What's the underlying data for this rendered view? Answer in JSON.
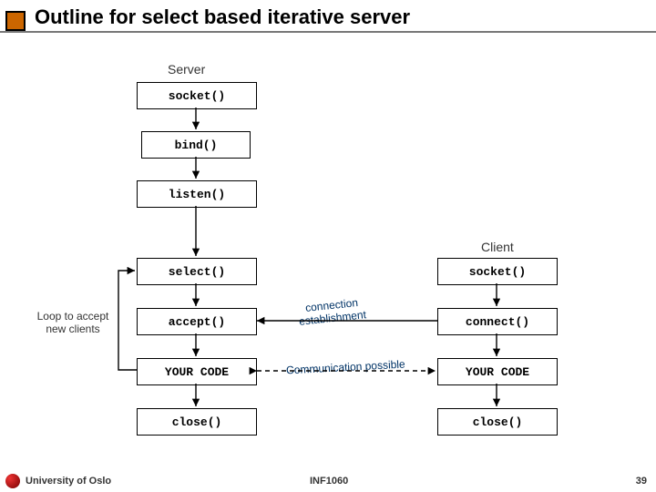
{
  "title": "Outline for select based iterative server",
  "server": {
    "heading": "Server",
    "socket": "socket()",
    "bind": "bind()",
    "listen": "listen()",
    "select": "select()",
    "accept": "accept()",
    "your_code": "YOUR CODE",
    "close": "close()"
  },
  "client": {
    "heading": "Client",
    "socket": "socket()",
    "connect": "connect()",
    "your_code": "YOUR CODE",
    "close": "close()"
  },
  "annotations": {
    "loop": "Loop to accept\nnew clients",
    "conn1": "connection",
    "conn2": "establishment",
    "comm": "Communication possible"
  },
  "footer": {
    "org": "University of Oslo",
    "course": "INF1060",
    "page": "39"
  }
}
